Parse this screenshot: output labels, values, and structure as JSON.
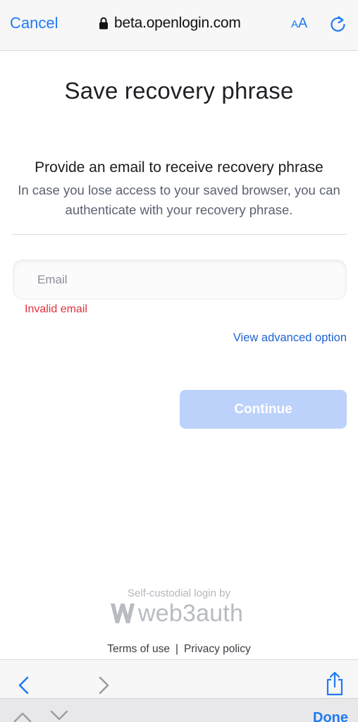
{
  "browser": {
    "cancel_label": "Cancel",
    "url": "beta.openlogin.com",
    "text_size_label_small": "A",
    "text_size_label_large": "A",
    "done_label": "Done"
  },
  "form": {
    "title": "Save recovery phrase",
    "subtitle": "Provide an email to receive recovery phrase",
    "description": "In case you lose access to your saved browser, you can authenticate with your recovery phrase.",
    "email_placeholder": "Email",
    "email_value": "",
    "error": "Invalid email",
    "advanced_link": "View advanced option",
    "continue_label": "Continue"
  },
  "footer": {
    "powered_by": "Self-custodial login by",
    "brand": "web3auth",
    "terms": "Terms of use",
    "separator": "|",
    "privacy": "Privacy policy"
  },
  "colors": {
    "accent": "#1f7bf2",
    "error": "#e2303b",
    "continue_disabled": "#bcd2fa"
  }
}
